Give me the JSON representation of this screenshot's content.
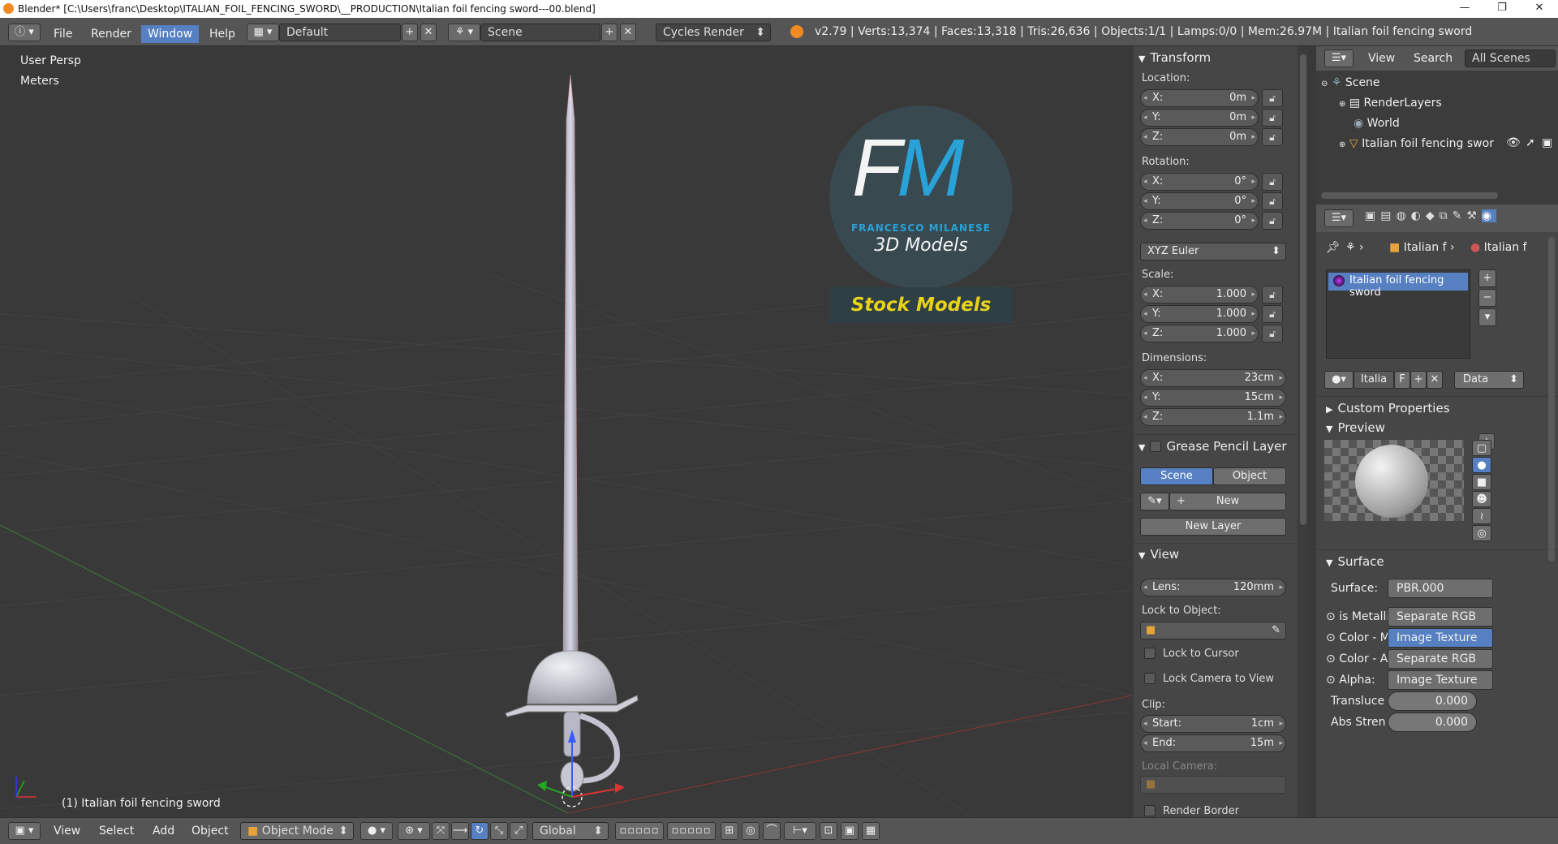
{
  "window": {
    "title": "Blender* [C:\\Users\\franc\\Desktop\\ITALIAN_FOIL_FENCING_SWORD\\__PRODUCTION\\Italian foil fencing sword---00.blend]",
    "controls": [
      "—",
      "❐",
      "✕"
    ]
  },
  "menu": {
    "items": [
      "File",
      "Render",
      "Window",
      "Help"
    ],
    "active": "Window"
  },
  "top": {
    "layout": "Default",
    "scene": "Scene",
    "engine": "Cycles Render",
    "stats": "v2.79 | Verts:13,374 | Faces:13,318 | Tris:26,636 | Objects:1/1 | Lamps:0/0 | Mem:26.97M | Italian foil fencing sword"
  },
  "viewport": {
    "view_name": "User Persp",
    "units": "Meters",
    "object_label": "(1) Italian foil fencing sword",
    "logo_letters": "FM",
    "logo_name": "FRANCESCO MILANESE",
    "logo_sub": "3D Models",
    "logo_banner": "Stock Models"
  },
  "transform": {
    "header": "Transform",
    "location_label": "Location:",
    "location": [
      {
        "k": "X:",
        "v": "0m"
      },
      {
        "k": "Y:",
        "v": "0m"
      },
      {
        "k": "Z:",
        "v": "0m"
      }
    ],
    "rotation_label": "Rotation:",
    "rotation": [
      {
        "k": "X:",
        "v": "0°"
      },
      {
        "k": "Y:",
        "v": "0°"
      },
      {
        "k": "Z:",
        "v": "0°"
      }
    ],
    "rotation_mode": "XYZ Euler",
    "scale_label": "Scale:",
    "scale": [
      {
        "k": "X:",
        "v": "1.000"
      },
      {
        "k": "Y:",
        "v": "1.000"
      },
      {
        "k": "Z:",
        "v": "1.000"
      }
    ],
    "dimensions_label": "Dimensions:",
    "dimensions": [
      {
        "k": "X:",
        "v": "23cm"
      },
      {
        "k": "Y:",
        "v": "15cm"
      },
      {
        "k": "Z:",
        "v": "1.1m"
      }
    ]
  },
  "grease": {
    "header": "Grease Pencil Layer",
    "tab_scene": "Scene",
    "tab_object": "Object",
    "new": "New",
    "new_layer": "New Layer"
  },
  "view": {
    "header": "View",
    "lens_k": "Lens:",
    "lens_v": "120mm",
    "lock_object": "Lock to Object:",
    "lock_cursor": "Lock to Cursor",
    "lock_camera": "Lock Camera to View",
    "clip": "Clip:",
    "start_k": "Start:",
    "start_v": "1cm",
    "end_k": "End:",
    "end_v": "15m",
    "local_camera": "Local Camera:",
    "render_border": "Render Border"
  },
  "outliner": {
    "view": "View",
    "search": "Search",
    "all_scenes": "All Scenes",
    "items": [
      "Scene",
      "RenderLayers",
      "World",
      "Italian foil fencing swor"
    ]
  },
  "properties": {
    "breadcrumb_1": "Italian f",
    "breadcrumb_2": "Italian f",
    "material": "Italian foil fencing sword",
    "mat_name": "Italia",
    "mat_f": "F",
    "data": "Data",
    "custom_props": "Custom Properties",
    "preview": "Preview",
    "surface_hdr": "Surface",
    "surface_k": "Surface:",
    "surface_v": "PBR.000",
    "inputs": [
      {
        "k": "is Metallic",
        "v": "Separate RGB"
      },
      {
        "k": "Color - Ma",
        "v": "Image Texture"
      },
      {
        "k": "Color - Ab",
        "v": "Separate RGB"
      },
      {
        "k": "Alpha:",
        "v": "Image Texture"
      }
    ],
    "translucence_k": "Transluce",
    "translucence_v": "0.000",
    "abs_k": "Abs Stren",
    "abs_v": "0.000"
  },
  "bottom": {
    "menus": [
      "View",
      "Select",
      "Add",
      "Object"
    ],
    "mode": "Object Mode",
    "orientation": "Global"
  },
  "colors": {
    "accent": "#5680c2",
    "header": "#555555",
    "panel": "#464646",
    "viewport": "#393939"
  }
}
